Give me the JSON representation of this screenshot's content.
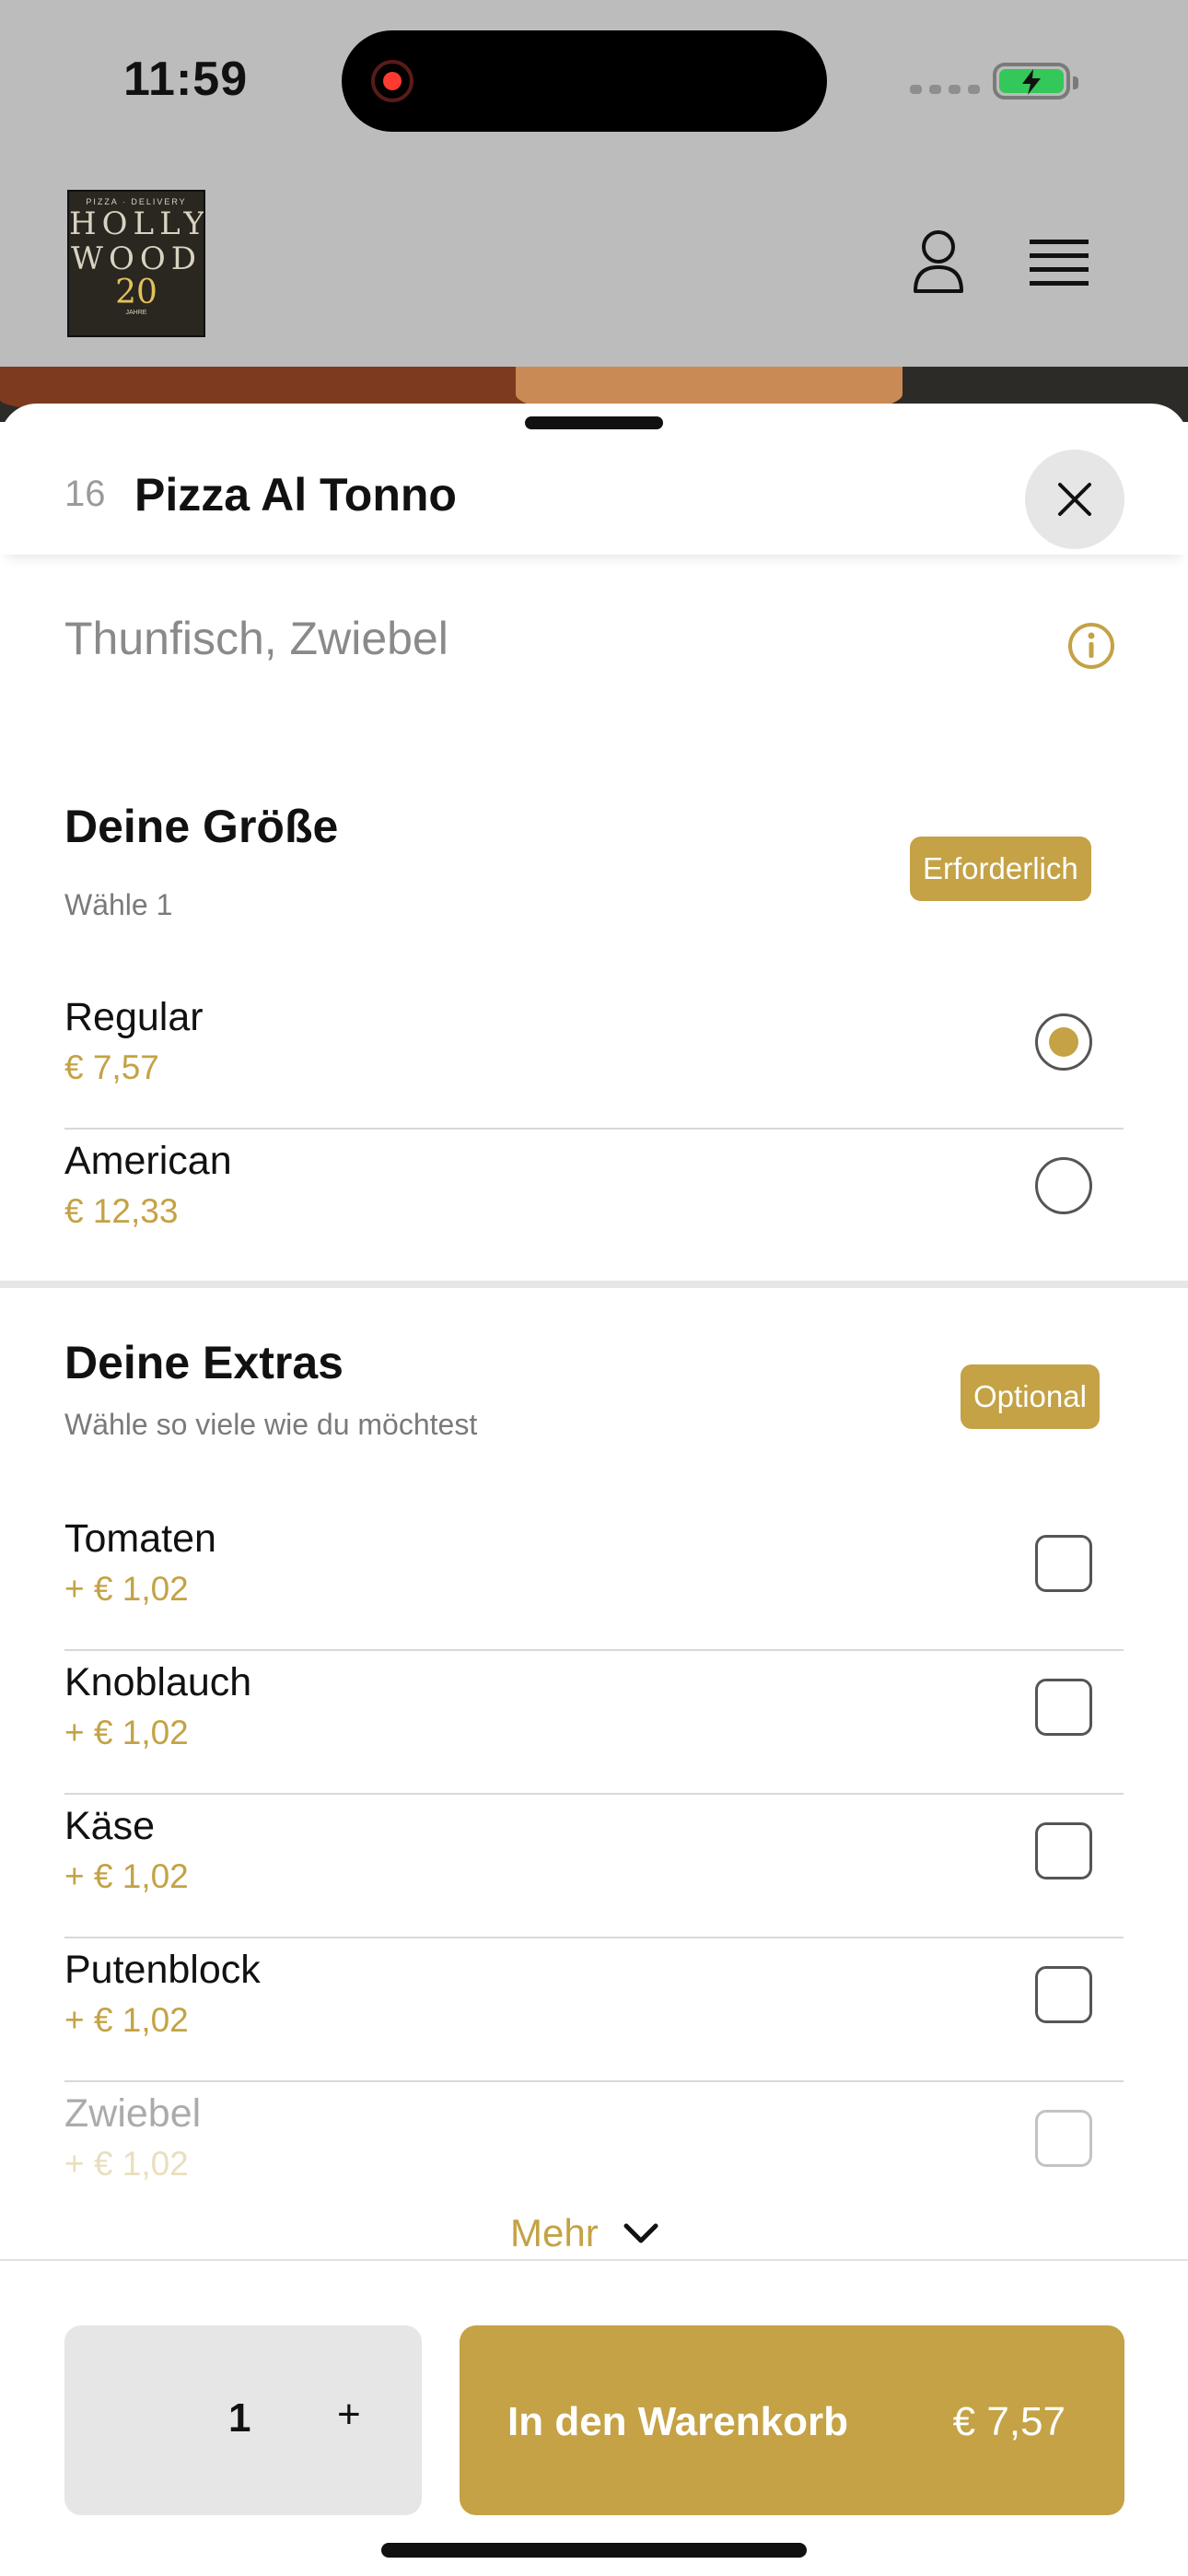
{
  "status_bar": {
    "time": "11:59"
  },
  "header": {
    "logo": {
      "small": "PIZZA · DELIVERY",
      "line1": "HOLLY",
      "line2": "WOOD",
      "number": "20",
      "tiny": "JAHRE"
    }
  },
  "item": {
    "number": "16",
    "title": "Pizza Al Tonno",
    "description": "Thunfisch, Zwiebel"
  },
  "size_section": {
    "title": "Deine Größe",
    "subtitle": "Wähle 1",
    "badge": "Erforderlich",
    "options": [
      {
        "name": "Regular",
        "price": "€ 7,57",
        "selected": true
      },
      {
        "name": "American",
        "price": "€ 12,33",
        "selected": false
      }
    ]
  },
  "extras_section": {
    "title": "Deine Extras",
    "subtitle": "Wähle so viele wie du möchtest",
    "badge": "Optional",
    "options": [
      {
        "name": "Tomaten",
        "price": "+ € 1,02"
      },
      {
        "name": "Knoblauch",
        "price": "+ € 1,02"
      },
      {
        "name": "Käse",
        "price": "+ € 1,02"
      },
      {
        "name": "Putenblock",
        "price": "+ € 1,02"
      },
      {
        "name": "Zwiebel",
        "price": "+ € 1,02"
      }
    ],
    "more_label": "Mehr"
  },
  "footer": {
    "quantity": "1",
    "plus": "+",
    "cart_label": "In den Warenkorb",
    "cart_price": "€ 7,57"
  },
  "colors": {
    "accent": "#c4a245",
    "dimmed_header": "#bcbcbc",
    "text": "#111111",
    "muted": "#8a8a8a"
  },
  "icons": [
    "record-icon",
    "signal-icon",
    "battery-icon",
    "user-icon",
    "menu-icon",
    "close-icon",
    "info-icon",
    "chevron-down-icon"
  ]
}
